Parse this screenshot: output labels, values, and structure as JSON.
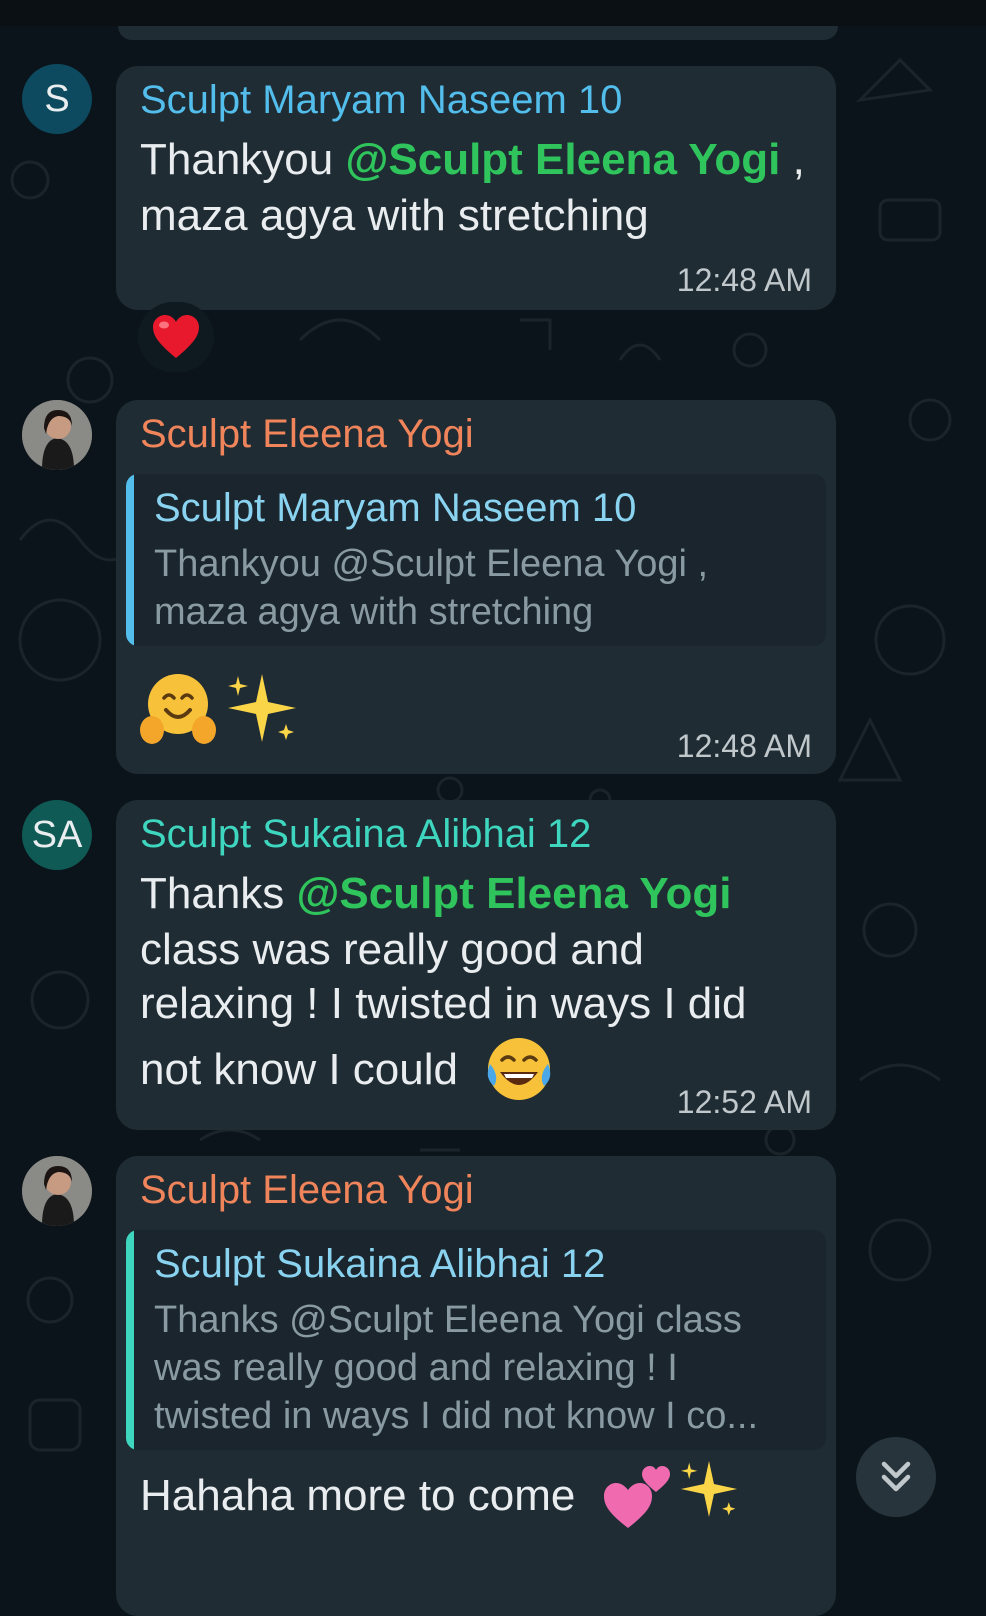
{
  "messages": [
    {
      "avatar": "S",
      "sender": "Sculpt Maryam Naseem 10",
      "text_before": "Thankyou ",
      "mention": "@Sculpt Eleena Yogi",
      "text_after": " ,",
      "line2": "maza agya with stretching",
      "time": "12:48 AM",
      "reaction": "heart-emoji"
    },
    {
      "avatar": "profile-photo",
      "sender": "Sculpt Eleena Yogi",
      "quote_sender": "Sculpt Maryam Naseem 10",
      "quote_text": "Thankyou @Sculpt Eleena Yogi ,\nmaza agya with stretching",
      "emojis": [
        "hugging-face-emoji",
        "sparkles-emoji"
      ],
      "time": "12:48 AM"
    },
    {
      "avatar": "SA",
      "sender": "Sculpt Sukaina Alibhai 12",
      "text_before": "Thanks ",
      "mention": "@Sculpt Eleena Yogi",
      "line2": "class was really good and",
      "line3": "relaxing ! I twisted in ways I did",
      "line4": "not know I could",
      "line4_emoji": "tears-of-joy-emoji",
      "time": "12:52 AM"
    },
    {
      "avatar": "profile-photo",
      "sender": "Sculpt Eleena Yogi",
      "quote_sender": "Sculpt Sukaina Alibhai 12",
      "quote_text": "Thanks @Sculpt Eleena Yogi class\nwas really good and relaxing ! I\ntwisted in ways I did not know I co...",
      "text": "Hahaha more to come",
      "emojis": [
        "two-hearts-emoji",
        "sparkles-emoji"
      ]
    }
  ],
  "colors": {
    "background": "#0b141a",
    "bubble": "#1f2c34",
    "mention": "#2fc45c",
    "sender_blue": "#53bdeb",
    "sender_orange": "#f0845a",
    "sender_teal": "#3ed6bf",
    "quote_bar_blue": "#53bdeb",
    "quote_bar_teal": "#3ed6bf"
  },
  "scroll_button_icon": "double-chevron-down-icon"
}
